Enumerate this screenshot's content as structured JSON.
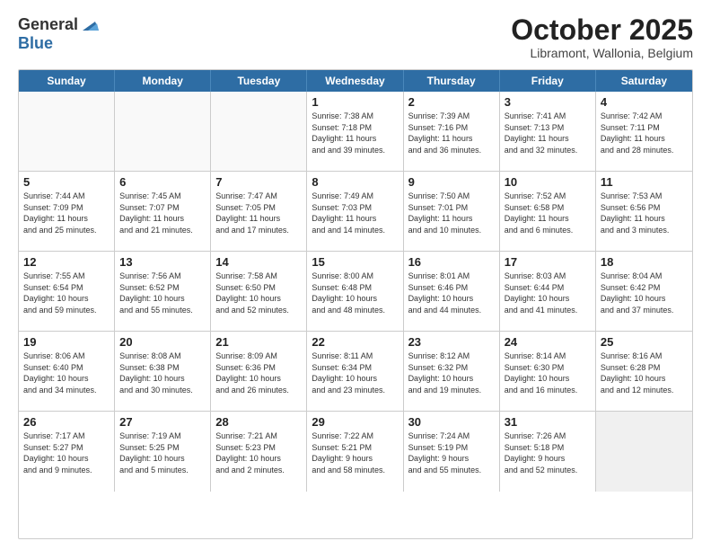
{
  "header": {
    "logo_line1": "General",
    "logo_line2": "Blue",
    "month": "October 2025",
    "location": "Libramont, Wallonia, Belgium"
  },
  "weekdays": [
    "Sunday",
    "Monday",
    "Tuesday",
    "Wednesday",
    "Thursday",
    "Friday",
    "Saturday"
  ],
  "weeks": [
    [
      {
        "day": "",
        "sunrise": "",
        "sunset": "",
        "daylight": ""
      },
      {
        "day": "",
        "sunrise": "",
        "sunset": "",
        "daylight": ""
      },
      {
        "day": "",
        "sunrise": "",
        "sunset": "",
        "daylight": ""
      },
      {
        "day": "1",
        "sunrise": "Sunrise: 7:38 AM",
        "sunset": "Sunset: 7:18 PM",
        "daylight": "Daylight: 11 hours and 39 minutes."
      },
      {
        "day": "2",
        "sunrise": "Sunrise: 7:39 AM",
        "sunset": "Sunset: 7:16 PM",
        "daylight": "Daylight: 11 hours and 36 minutes."
      },
      {
        "day": "3",
        "sunrise": "Sunrise: 7:41 AM",
        "sunset": "Sunset: 7:13 PM",
        "daylight": "Daylight: 11 hours and 32 minutes."
      },
      {
        "day": "4",
        "sunrise": "Sunrise: 7:42 AM",
        "sunset": "Sunset: 7:11 PM",
        "daylight": "Daylight: 11 hours and 28 minutes."
      }
    ],
    [
      {
        "day": "5",
        "sunrise": "Sunrise: 7:44 AM",
        "sunset": "Sunset: 7:09 PM",
        "daylight": "Daylight: 11 hours and 25 minutes."
      },
      {
        "day": "6",
        "sunrise": "Sunrise: 7:45 AM",
        "sunset": "Sunset: 7:07 PM",
        "daylight": "Daylight: 11 hours and 21 minutes."
      },
      {
        "day": "7",
        "sunrise": "Sunrise: 7:47 AM",
        "sunset": "Sunset: 7:05 PM",
        "daylight": "Daylight: 11 hours and 17 minutes."
      },
      {
        "day": "8",
        "sunrise": "Sunrise: 7:49 AM",
        "sunset": "Sunset: 7:03 PM",
        "daylight": "Daylight: 11 hours and 14 minutes."
      },
      {
        "day": "9",
        "sunrise": "Sunrise: 7:50 AM",
        "sunset": "Sunset: 7:01 PM",
        "daylight": "Daylight: 11 hours and 10 minutes."
      },
      {
        "day": "10",
        "sunrise": "Sunrise: 7:52 AM",
        "sunset": "Sunset: 6:58 PM",
        "daylight": "Daylight: 11 hours and 6 minutes."
      },
      {
        "day": "11",
        "sunrise": "Sunrise: 7:53 AM",
        "sunset": "Sunset: 6:56 PM",
        "daylight": "Daylight: 11 hours and 3 minutes."
      }
    ],
    [
      {
        "day": "12",
        "sunrise": "Sunrise: 7:55 AM",
        "sunset": "Sunset: 6:54 PM",
        "daylight": "Daylight: 10 hours and 59 minutes."
      },
      {
        "day": "13",
        "sunrise": "Sunrise: 7:56 AM",
        "sunset": "Sunset: 6:52 PM",
        "daylight": "Daylight: 10 hours and 55 minutes."
      },
      {
        "day": "14",
        "sunrise": "Sunrise: 7:58 AM",
        "sunset": "Sunset: 6:50 PM",
        "daylight": "Daylight: 10 hours and 52 minutes."
      },
      {
        "day": "15",
        "sunrise": "Sunrise: 8:00 AM",
        "sunset": "Sunset: 6:48 PM",
        "daylight": "Daylight: 10 hours and 48 minutes."
      },
      {
        "day": "16",
        "sunrise": "Sunrise: 8:01 AM",
        "sunset": "Sunset: 6:46 PM",
        "daylight": "Daylight: 10 hours and 44 minutes."
      },
      {
        "day": "17",
        "sunrise": "Sunrise: 8:03 AM",
        "sunset": "Sunset: 6:44 PM",
        "daylight": "Daylight: 10 hours and 41 minutes."
      },
      {
        "day": "18",
        "sunrise": "Sunrise: 8:04 AM",
        "sunset": "Sunset: 6:42 PM",
        "daylight": "Daylight: 10 hours and 37 minutes."
      }
    ],
    [
      {
        "day": "19",
        "sunrise": "Sunrise: 8:06 AM",
        "sunset": "Sunset: 6:40 PM",
        "daylight": "Daylight: 10 hours and 34 minutes."
      },
      {
        "day": "20",
        "sunrise": "Sunrise: 8:08 AM",
        "sunset": "Sunset: 6:38 PM",
        "daylight": "Daylight: 10 hours and 30 minutes."
      },
      {
        "day": "21",
        "sunrise": "Sunrise: 8:09 AM",
        "sunset": "Sunset: 6:36 PM",
        "daylight": "Daylight: 10 hours and 26 minutes."
      },
      {
        "day": "22",
        "sunrise": "Sunrise: 8:11 AM",
        "sunset": "Sunset: 6:34 PM",
        "daylight": "Daylight: 10 hours and 23 minutes."
      },
      {
        "day": "23",
        "sunrise": "Sunrise: 8:12 AM",
        "sunset": "Sunset: 6:32 PM",
        "daylight": "Daylight: 10 hours and 19 minutes."
      },
      {
        "day": "24",
        "sunrise": "Sunrise: 8:14 AM",
        "sunset": "Sunset: 6:30 PM",
        "daylight": "Daylight: 10 hours and 16 minutes."
      },
      {
        "day": "25",
        "sunrise": "Sunrise: 8:16 AM",
        "sunset": "Sunset: 6:28 PM",
        "daylight": "Daylight: 10 hours and 12 minutes."
      }
    ],
    [
      {
        "day": "26",
        "sunrise": "Sunrise: 7:17 AM",
        "sunset": "Sunset: 5:27 PM",
        "daylight": "Daylight: 10 hours and 9 minutes."
      },
      {
        "day": "27",
        "sunrise": "Sunrise: 7:19 AM",
        "sunset": "Sunset: 5:25 PM",
        "daylight": "Daylight: 10 hours and 5 minutes."
      },
      {
        "day": "28",
        "sunrise": "Sunrise: 7:21 AM",
        "sunset": "Sunset: 5:23 PM",
        "daylight": "Daylight: 10 hours and 2 minutes."
      },
      {
        "day": "29",
        "sunrise": "Sunrise: 7:22 AM",
        "sunset": "Sunset: 5:21 PM",
        "daylight": "Daylight: 9 hours and 58 minutes."
      },
      {
        "day": "30",
        "sunrise": "Sunrise: 7:24 AM",
        "sunset": "Sunset: 5:19 PM",
        "daylight": "Daylight: 9 hours and 55 minutes."
      },
      {
        "day": "31",
        "sunrise": "Sunrise: 7:26 AM",
        "sunset": "Sunset: 5:18 PM",
        "daylight": "Daylight: 9 hours and 52 minutes."
      },
      {
        "day": "",
        "sunrise": "",
        "sunset": "",
        "daylight": ""
      }
    ]
  ]
}
